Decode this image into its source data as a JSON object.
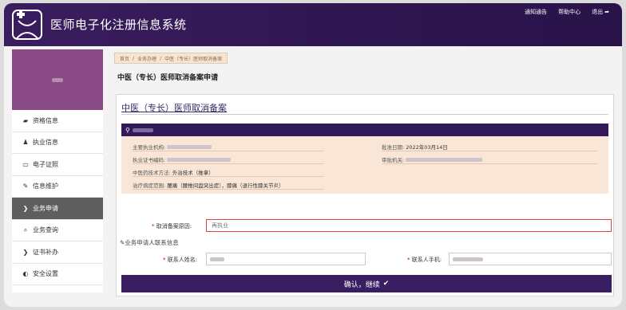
{
  "app": {
    "title": "医师电子化注册信息系统"
  },
  "top_links": [
    {
      "label": "通知通告",
      "icon": ""
    },
    {
      "label": "帮助中心",
      "icon": ""
    },
    {
      "label": "退出",
      "icon": "exit-icon"
    }
  ],
  "sidebar": {
    "items": [
      {
        "label": "资格信息",
        "icon": "book-icon",
        "active": false
      },
      {
        "label": "执业信息",
        "icon": "users-icon",
        "active": false
      },
      {
        "label": "电子证照",
        "icon": "card-icon",
        "active": false
      },
      {
        "label": "信息维护",
        "icon": "edit-icon",
        "active": false
      },
      {
        "label": "业务申请",
        "icon": "chevron-right-icon",
        "active": true
      },
      {
        "label": "业务查询",
        "icon": "search-icon",
        "active": false
      },
      {
        "label": "证书补办",
        "icon": "chevron-right-icon",
        "active": false
      },
      {
        "label": "安全设置",
        "icon": "shield-icon",
        "active": false
      }
    ]
  },
  "breadcrumb": [
    "首页",
    "业务办理",
    "中医（专长）医师取消备案"
  ],
  "page_title": "中医（专长）医师取消备案申请",
  "panel": {
    "title": "中医（专长）医师取消备案",
    "info": {
      "main_org_label": "主要执业机构:",
      "approve_date_label": "批准日期:",
      "approve_date": "2022年03月14日",
      "cert_no_label": "执业证书编码:",
      "approve_org_label": "审批机关:",
      "tech_label": "中医药技术方法:",
      "tech_value": "外治技术（推拿）",
      "scope_label": "治疗病症范围:",
      "scope_value": "腰痛（腰椎间盘突出症），膝痛（退行性膝关节炎）"
    }
  },
  "form": {
    "reason_label": "取消备案原因:",
    "reason_value": "再执业",
    "contact_section_title": "业务申请人联系信息",
    "contact_name_label": "联系人姓名:",
    "contact_phone_label": "联系人手机:",
    "submit_label": "确认，继续"
  },
  "colors": {
    "brand": "#32195a",
    "accent": "#8a4a86",
    "info_bg": "#f9e6d6",
    "error_border": "#dd4444"
  }
}
